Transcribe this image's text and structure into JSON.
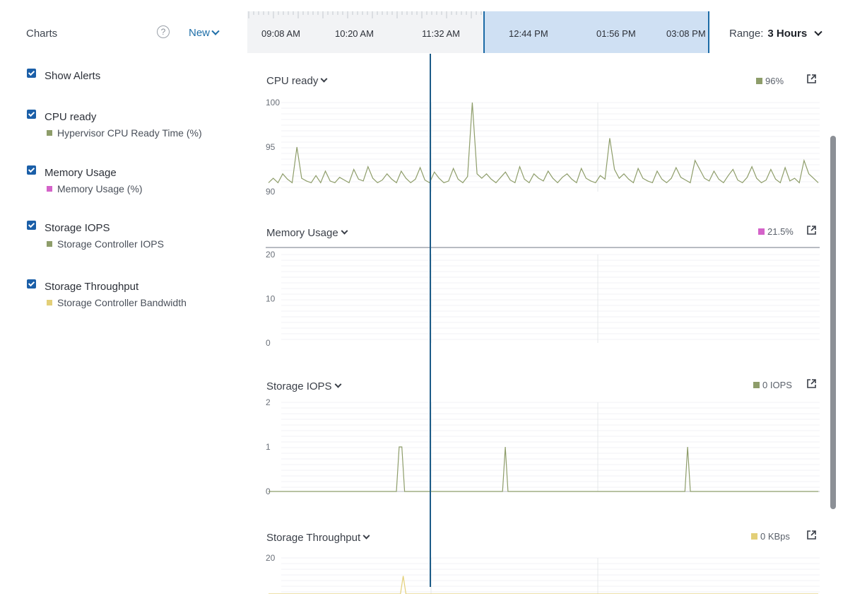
{
  "header": {
    "charts_label": "Charts",
    "help_glyph": "?",
    "new_label": "New",
    "range_label": "Range:",
    "range_value": "3 Hours"
  },
  "timeline": {
    "labels": [
      "09:08 AM",
      "10:20 AM",
      "11:32 AM",
      "12:44 PM",
      "01:56 PM",
      "03:08 PM"
    ]
  },
  "legend": {
    "show_alerts": "Show Alerts",
    "items": [
      {
        "title": "CPU ready",
        "metric": "Hypervisor CPU Ready Time (%)",
        "color": "#8e9d6a"
      },
      {
        "title": "Memory Usage",
        "metric": "Memory Usage (%)",
        "color": "#d463c9"
      },
      {
        "title": "Storage IOPS",
        "metric": "Storage Controller IOPS",
        "color": "#8e9d6a"
      },
      {
        "title": "Storage Throughput",
        "metric": "Storage Controller Bandwidth",
        "color": "#e3cf78"
      }
    ]
  },
  "charts": [
    {
      "title": "CPU ready",
      "current": "96%",
      "color": "#8e9d6a",
      "yticks": [
        "100",
        "95",
        "90"
      ]
    },
    {
      "title": "Memory Usage",
      "current": "21.5%",
      "color": "#d463c9",
      "yticks": [
        "20",
        "10",
        "0"
      ]
    },
    {
      "title": "Storage IOPS",
      "current": "0 IOPS",
      "color": "#8e9d6a",
      "yticks": [
        "2",
        "1",
        "0"
      ]
    },
    {
      "title": "Storage Throughput",
      "current": "0 KBps",
      "color": "#e3cf78",
      "yticks": [
        "20"
      ]
    }
  ],
  "chart_data": [
    {
      "type": "line",
      "title": "CPU ready",
      "ylim": [
        90,
        100
      ],
      "series": [
        {
          "name": "Hypervisor CPU Ready Time (%)",
          "values": [
            91,
            91.5,
            91,
            92,
            91.4,
            91,
            95,
            91.5,
            91.2,
            91,
            91.8,
            91,
            92.3,
            91.2,
            91,
            91.6,
            91.3,
            91,
            92.5,
            91.4,
            91.2,
            92.8,
            91.5,
            91,
            91.3,
            92,
            91.4,
            91,
            92.3,
            91.5,
            91,
            91.4,
            92.7,
            91.3,
            91,
            92.2,
            91.5,
            91,
            91.2,
            92.6,
            91.4,
            91,
            91.7,
            100,
            92,
            91.5,
            92,
            91.4,
            91,
            91.6,
            92.2,
            91.3,
            91,
            92.8,
            91.4,
            91,
            92,
            91.5,
            91.2,
            92.3,
            91.5,
            91,
            91.6,
            92,
            91.4,
            91,
            92.6,
            91.5,
            91.2,
            91,
            91.8,
            91.4,
            96,
            92.5,
            91.5,
            92,
            91.4,
            91,
            92.6,
            91.5,
            91.2,
            91,
            92.3,
            91.4,
            91,
            91.5,
            92.7,
            91.6,
            91.3,
            91,
            93.5,
            92.5,
            91.5,
            91.2,
            92.3,
            91.4,
            91,
            91.8,
            92.5,
            91.3,
            91,
            91.6,
            92.8,
            91.5,
            91,
            91.3,
            92.5,
            91.4,
            91,
            92.7,
            91.2,
            91.5,
            91,
            93.5,
            92,
            91.5,
            91
          ]
        }
      ],
      "x_ticks": [
        "09:08 AM",
        "10:20 AM",
        "11:32 AM",
        "12:44 PM",
        "01:56 PM",
        "03:08 PM"
      ]
    },
    {
      "type": "line",
      "title": "Memory Usage",
      "ylim": [
        0,
        20
      ],
      "series": [
        {
          "name": "Memory Usage (%)",
          "values": [
            21.5,
            21.5,
            21.5,
            21.5,
            21.5,
            21.5,
            21.5,
            21.5,
            21.5,
            21.5,
            21.5,
            21.5,
            21.5,
            21.5,
            21.5,
            21.5,
            21.5,
            21.5,
            21.5,
            21.5
          ]
        }
      ]
    },
    {
      "type": "line",
      "title": "Storage IOPS",
      "ylim": [
        0,
        2
      ],
      "series": [
        {
          "name": "Storage Controller IOPS",
          "values": [
            0,
            0,
            0,
            0,
            0,
            0,
            0,
            0,
            0,
            0,
            0,
            0,
            0,
            0,
            0,
            0,
            0,
            0,
            0,
            0,
            0,
            0,
            0,
            0,
            0,
            0,
            0,
            0,
            0,
            0,
            0,
            0,
            0,
            0,
            0,
            0,
            0,
            0,
            0,
            0,
            0,
            0,
            0,
            0,
            0,
            0,
            0,
            0,
            1,
            1,
            0,
            0,
            0,
            0,
            0,
            0,
            0,
            0,
            0,
            0,
            0,
            0,
            0,
            0,
            0,
            0,
            0,
            0,
            0,
            0,
            0,
            0,
            0,
            0,
            0,
            0,
            0,
            0,
            0,
            0,
            0,
            0,
            0,
            0,
            0,
            0,
            0,
            1,
            0,
            0,
            0,
            0,
            0,
            0,
            0,
            0,
            0,
            0,
            0,
            0,
            0,
            0,
            0,
            0,
            0,
            0,
            0,
            0,
            0,
            0,
            0,
            0,
            0,
            0,
            0,
            0,
            0,
            0,
            0,
            0,
            0,
            0,
            0,
            0,
            0,
            0,
            0,
            0,
            0,
            0,
            0,
            0,
            0,
            0,
            0,
            0,
            0,
            0,
            0,
            0,
            0,
            0,
            0,
            0,
            0,
            0,
            0,
            0,
            0,
            0,
            0,
            0,
            0,
            0,
            1,
            0,
            0,
            0,
            0,
            0,
            0,
            0,
            0,
            0,
            0,
            0,
            0,
            0,
            0,
            0,
            0,
            0,
            0,
            0,
            0,
            0,
            0,
            0,
            0,
            0,
            0,
            0,
            0,
            0,
            0,
            0,
            0,
            0,
            0,
            0,
            0,
            0,
            0,
            0,
            0,
            0,
            0,
            0,
            0,
            0,
            0,
            0,
            0
          ]
        }
      ]
    },
    {
      "type": "line",
      "title": "Storage Throughput",
      "ylim": [
        0,
        20
      ],
      "series": [
        {
          "name": "Storage Controller Bandwidth",
          "values": [
            0,
            0,
            0,
            0,
            0,
            0,
            0,
            0,
            0,
            0,
            0,
            0,
            0,
            0,
            0,
            0,
            0,
            0,
            0,
            0,
            0,
            0,
            0,
            0,
            0,
            0,
            0,
            0,
            0,
            0,
            0,
            0,
            0,
            0,
            0,
            0,
            0,
            0,
            0,
            0,
            0,
            0,
            0,
            0,
            0,
            0,
            0,
            0,
            0,
            10,
            0,
            0,
            0,
            0,
            0,
            0,
            0,
            0,
            0,
            0,
            0,
            0,
            0,
            0,
            0,
            0,
            0,
            0,
            0,
            0,
            0,
            0,
            0,
            0,
            0,
            0,
            0,
            0,
            0,
            0,
            0,
            0,
            0,
            0,
            0,
            0,
            0,
            0,
            0,
            0,
            0,
            0,
            0,
            0,
            0,
            0,
            0,
            0,
            0,
            0,
            0,
            0,
            0,
            0,
            0,
            0,
            0,
            0,
            0,
            0,
            0,
            0,
            0,
            0,
            0,
            0,
            0,
            0,
            0,
            0,
            0,
            0,
            0,
            0,
            0,
            0,
            0,
            0,
            0,
            0,
            0,
            0,
            0,
            0,
            0,
            0,
            0,
            0,
            0,
            0,
            0,
            0,
            0,
            0,
            0,
            0,
            0,
            0,
            0,
            0,
            0,
            0,
            0,
            0,
            0,
            0,
            0,
            0,
            0,
            0,
            0,
            0,
            0,
            0,
            0,
            0,
            0,
            0,
            0,
            0,
            0,
            0,
            0,
            0,
            0,
            0,
            0,
            0,
            0,
            0,
            0,
            0,
            0,
            0,
            0,
            0,
            0,
            0,
            0,
            0,
            0,
            0,
            0,
            0,
            0,
            0,
            0,
            0,
            0,
            0,
            0
          ]
        }
      ]
    }
  ]
}
